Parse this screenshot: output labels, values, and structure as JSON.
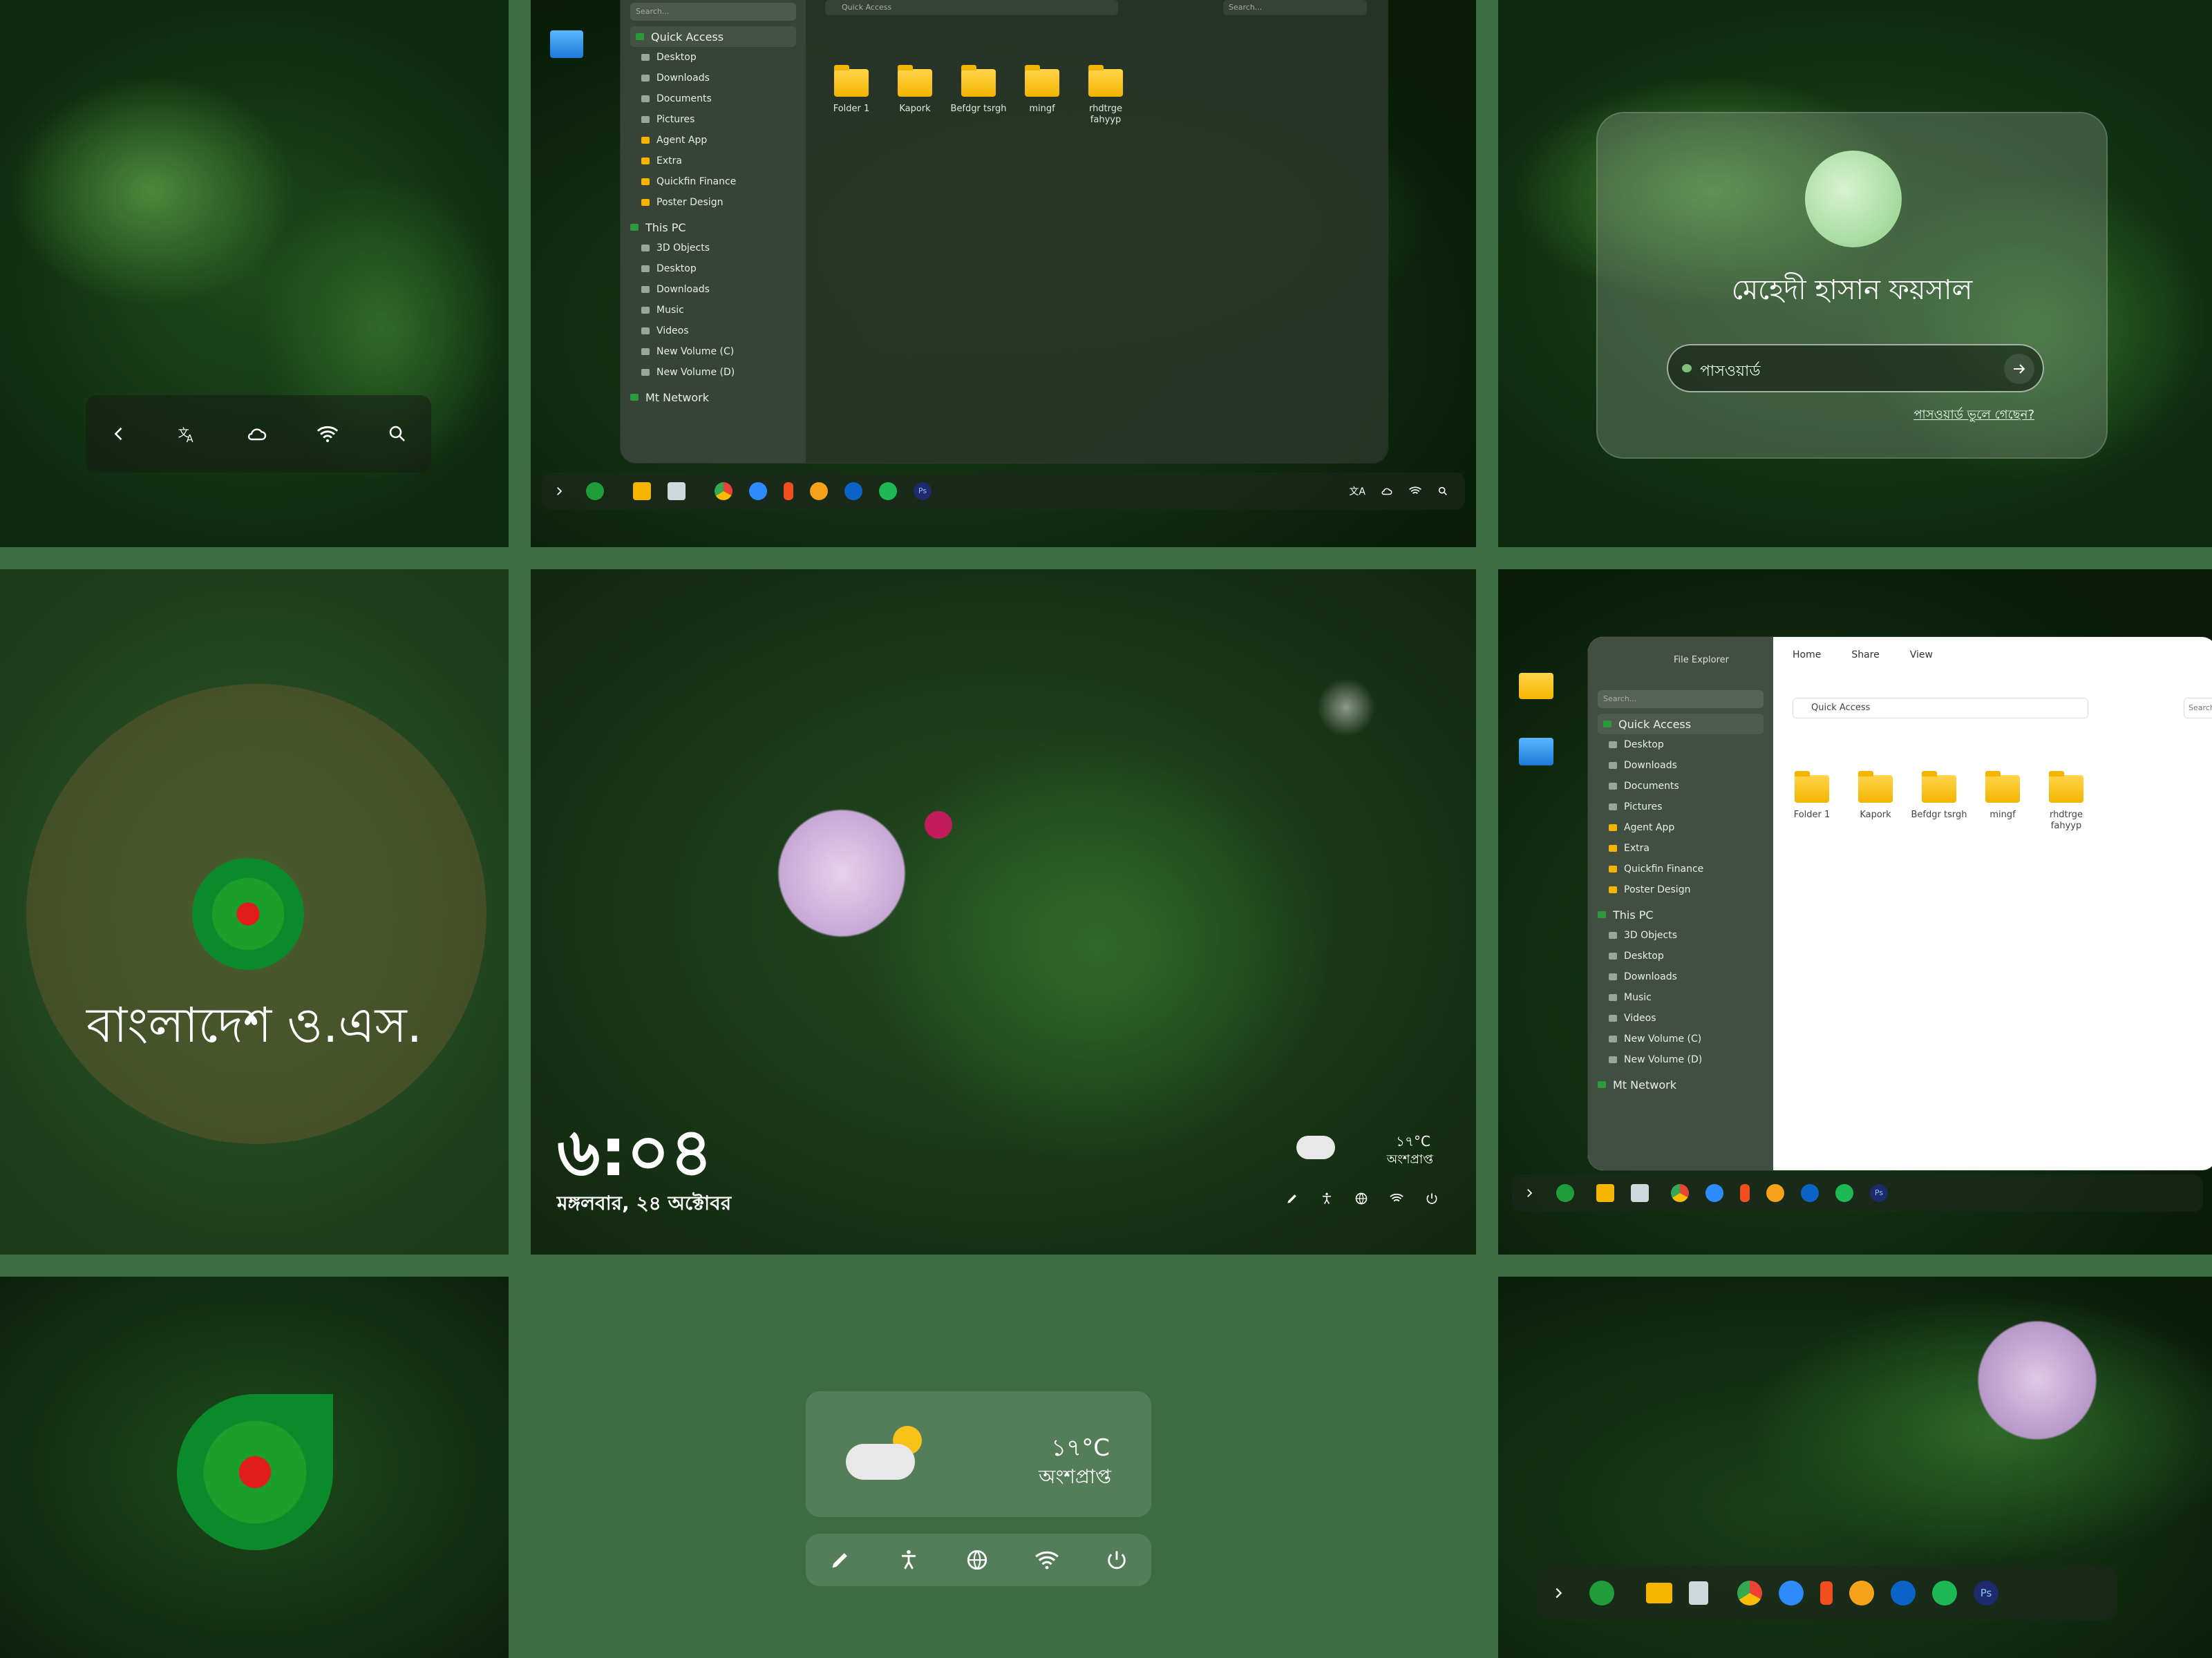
{
  "colors": {
    "page_bg": "#3d6b42",
    "accent_green": "#0a8a2a",
    "flag_red": "#e01c1c",
    "folder_yellow": "#f4b400"
  },
  "lockscreen_controls": {
    "icons": [
      "back-icon",
      "translate-icon",
      "cloud-icon",
      "wifi-icon",
      "search-icon"
    ]
  },
  "explorer_dark": {
    "search_placeholder": "Search...",
    "path": "Quick Access",
    "search_right": "Search...",
    "sidebar": {
      "quick_access": "Quick Access",
      "quick_items": [
        "Desktop",
        "Downloads",
        "Documents",
        "Pictures",
        "Agent App",
        "Extra",
        "Quickfin Finance",
        "Poster Design"
      ],
      "this_pc": "This PC",
      "pc_items": [
        "3D Objects",
        "Desktop",
        "Downloads",
        "Music",
        "Videos",
        "New Volume (C)",
        "New Volume (D)"
      ],
      "network": "Mt Network"
    },
    "files": [
      "Folder 1",
      "Kapork",
      "Befdgr tsrgh",
      "mingf",
      "rhdtrge fahyyp"
    ]
  },
  "login": {
    "username": "মেহেদী হাসান ফয়সাল",
    "password_placeholder": "পাসওয়ার্ড",
    "forgot": "পাসওয়ার্ড ভুলে গেছেন?"
  },
  "brand": {
    "name": "বাংলাদেশ ও.এস."
  },
  "lockscreen": {
    "time": "৬:০৪",
    "date": "মঙ্গলবার, ২৪ অক্টোবর",
    "temp": "১৭°C",
    "condition": "অংশপ্রাপ্ত"
  },
  "explorer_light": {
    "title": "File Explorer",
    "ribbon": [
      "Home",
      "Share",
      "View"
    ],
    "path": "Quick Access",
    "search_placeholder": "Search...",
    "search_right": "Search",
    "sidebar": {
      "quick_access": "Quick Access",
      "quick_items": [
        "Desktop",
        "Downloads",
        "Documents",
        "Pictures",
        "Agent App",
        "Extra",
        "Quickfin Finance",
        "Poster Design"
      ],
      "this_pc": "This PC",
      "pc_items": [
        "3D Objects",
        "Desktop",
        "Downloads",
        "Music",
        "Videos",
        "New Volume (C)",
        "New Volume (D)"
      ],
      "network": "Mt Network"
    },
    "files": [
      "Folder 1",
      "Kapork",
      "Befdgr tsrgh",
      "mingf",
      "rhdtrge fahyyp"
    ]
  },
  "weather_widget": {
    "temp": "১৭°C",
    "condition": "অংশপ্রাপ্ত"
  },
  "taskbar": {
    "apps": [
      "ps-label"
    ],
    "ps": "Ps"
  }
}
